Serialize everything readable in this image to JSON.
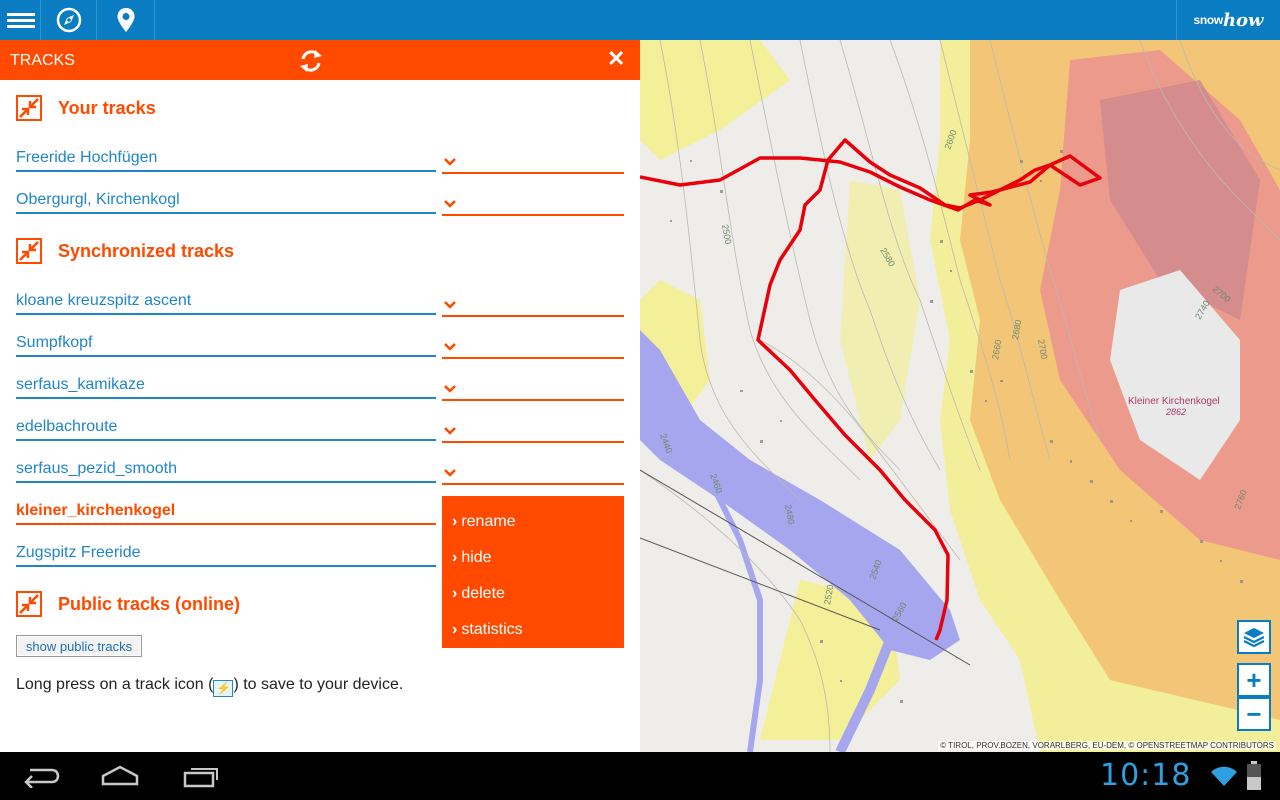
{
  "topbar": {
    "brand_prefix": "snow",
    "brand_suffix": "how"
  },
  "panel": {
    "title": "TRACKS",
    "sections": {
      "your_tracks": "Your tracks",
      "synced": "Synchronized tracks",
      "public": "Public tracks (online)"
    },
    "your_tracks": [
      "Freeride Hochfügen",
      "Obergurgl, Kirchenkogl"
    ],
    "synced_tracks": [
      "kloane kreuzspitz ascent",
      "Sumpfkopf",
      "serfaus_kamikaze",
      "edelbachroute",
      "serfaus_pezid_smooth",
      "kleiner_kirchenkogel",
      "Zugspitz Freeride"
    ],
    "context_menu": [
      "rename",
      "hide",
      "delete",
      "statistics"
    ],
    "show_public_button": "show public tracks",
    "hint_before": "Long press on a track icon (",
    "hint_after": ") to save to your device."
  },
  "map": {
    "attribution": "© TIROL, PROV.BOZEN, VORARLBERG, EU-DEM, © OPENSTREETMAP CONTRIBUTORS",
    "peak_name": "Kleiner Kirchenkogel",
    "peak_elev": "2862",
    "contours": [
      "2600",
      "2500",
      "2580",
      "2660",
      "2700",
      "2680",
      "2740",
      "2700",
      "2440",
      "2460",
      "2480",
      "2540",
      "2520",
      "2560",
      "2760"
    ],
    "zoom_in": "+",
    "zoom_out": "−"
  },
  "status": {
    "time": "10:18"
  },
  "colors": {
    "accent": "#ff4a00",
    "topbar": "#0a7cc2",
    "link": "#1f86c8",
    "track": "#e8000b"
  }
}
